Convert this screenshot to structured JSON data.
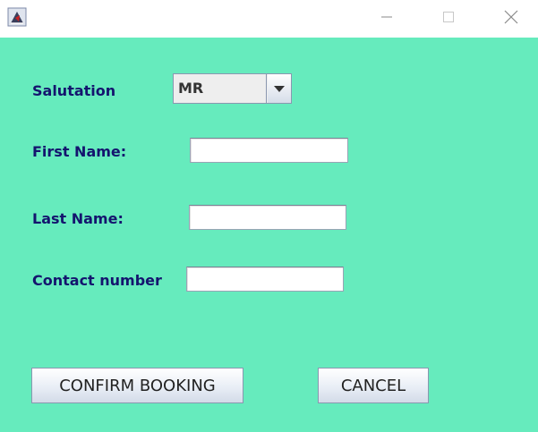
{
  "window": {
    "icons": {
      "app": "java-app-icon",
      "minimize": "minimize-icon",
      "maximize": "maximize-icon",
      "close": "close-icon"
    }
  },
  "form": {
    "salutation_label": "Salutation",
    "salutation_value": "MR",
    "first_name_label": "First Name:",
    "first_name_value": "",
    "last_name_label": "Last Name:",
    "last_name_value": "",
    "contact_label": "Contact number",
    "contact_value": ""
  },
  "buttons": {
    "confirm_label": "CONFIRM BOOKING",
    "cancel_label": "CANCEL"
  },
  "colors": {
    "background": "#66ebbd",
    "label": "#14146e"
  }
}
